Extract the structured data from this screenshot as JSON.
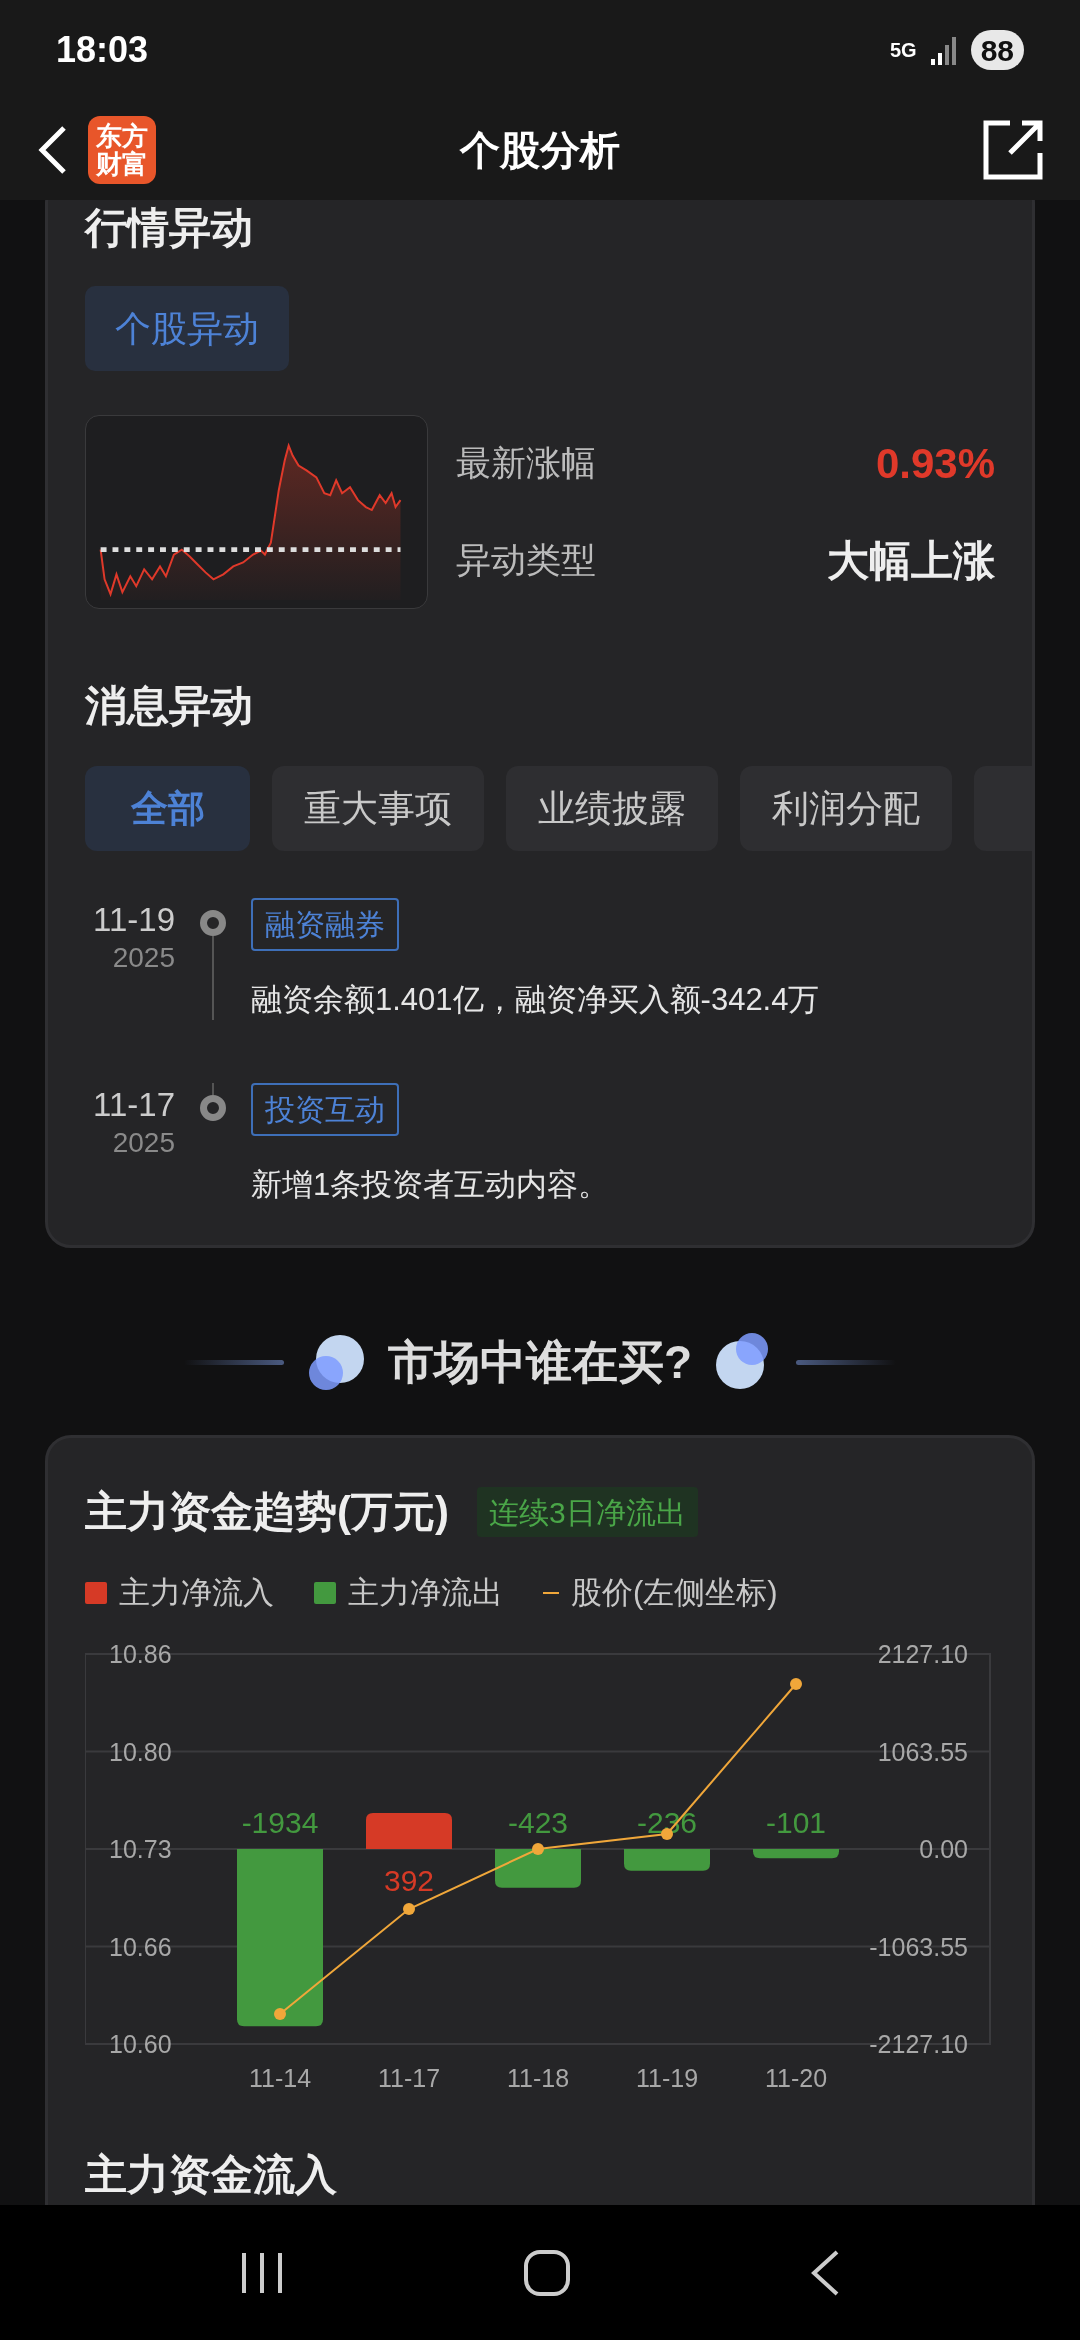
{
  "status_bar": {
    "time": "18:03",
    "network": "5G",
    "battery": "88"
  },
  "header": {
    "logo_lines": [
      "东方",
      "财富"
    ],
    "title": "个股分析"
  },
  "anomaly": {
    "title": "行情异动",
    "chip": "个股异动",
    "metrics": [
      {
        "label": "最新涨幅",
        "value": "0.93%",
        "color": "#e0392a"
      },
      {
        "label": "异动类型",
        "value": "大幅上涨",
        "color": "#eeeeee"
      }
    ]
  },
  "news": {
    "title": "消息异动",
    "tabs": [
      {
        "label": "全部",
        "selected": true
      },
      {
        "label": "重大事项",
        "selected": false
      },
      {
        "label": "业绩披露",
        "selected": false
      },
      {
        "label": "利润分配",
        "selected": false
      },
      {
        "selected": false
      }
    ],
    "events": [
      {
        "date": "11-19",
        "year": "2025",
        "tag": "融资融券",
        "text": "融资余额1.401亿，融资净买入额-342.4万"
      },
      {
        "date": "11-17",
        "year": "2025",
        "tag": "投资互动",
        "text": "新增1条投资者互动内容。"
      }
    ]
  },
  "section_heading": "市场中谁在买?",
  "fund_trend": {
    "title": "主力资金趋势(万元)",
    "badge": "连续3日净流出",
    "flow_chart": {
      "chart_data": {
        "type": "bar",
        "categories": [
          "11-14",
          "11-17",
          "11-18",
          "11-19",
          "11-20"
        ],
        "series": [
          {
            "name": "主力净流入",
            "color": "#d63a26",
            "values": [
              null,
              392,
              null,
              null,
              null
            ],
            "value_labels": [
              null,
              "392",
              null,
              null,
              null
            ]
          },
          {
            "name": "主力净流出",
            "color": "#43993f",
            "values": [
              -1934,
              null,
              -423,
              -236,
              -101
            ],
            "value_labels": [
              "-1934",
              null,
              "-423",
              "-236",
              "-101"
            ]
          }
        ],
        "ylim": [
          -2127.1,
          2127.1
        ],
        "yticks": [
          {
            "value": 2127.1,
            "label": "2127.10"
          },
          {
            "value": 1063.55,
            "label": "1063.55"
          },
          {
            "value": 0,
            "label": "0.00"
          },
          {
            "value": -1063.55,
            "label": "-1063.55"
          },
          {
            "value": -2127.1,
            "label": "-2127.10"
          }
        ],
        "grid": true
      }
    },
    "price_chart": {
      "chart_data": {
        "type": "line",
        "series": [
          {
            "name": "股价(左侧坐标)",
            "color": "#f0a73a",
            "marker": "circle",
            "values": [
              10.62,
              10.69,
              10.73,
              10.74,
              10.84
            ]
          }
        ],
        "ylim": [
          10.6,
          10.86
        ],
        "yticks": [
          {
            "value": 10.86,
            "label": "10.86"
          },
          {
            "value": 10.795,
            "label": "10.80"
          },
          {
            "value": 10.73,
            "label": "10.73"
          },
          {
            "value": 10.665,
            "label": "10.66"
          },
          {
            "value": 10.6,
            "label": "10.60"
          }
        ]
      }
    }
  },
  "next_section": {
    "title": "主力资金流入"
  }
}
